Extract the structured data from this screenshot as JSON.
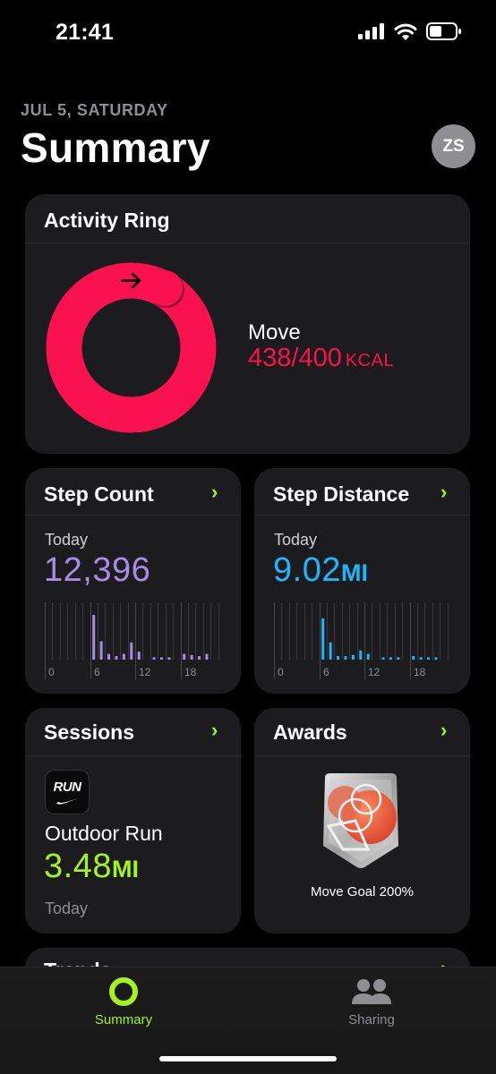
{
  "status_bar": {
    "time": "21:41"
  },
  "header": {
    "date": "JUL 5, SATURDAY",
    "title": "Summary",
    "avatar_initials": "ZS"
  },
  "activity_ring": {
    "title": "Activity Ring",
    "move_label": "Move",
    "move_value": "438/400",
    "move_unit": "KCAL",
    "progress_fraction": 1.095,
    "color": "#fa114f"
  },
  "step_count": {
    "title": "Step Count",
    "period": "Today",
    "value": "12,396",
    "color": "#a68ce8",
    "chart_ticks": [
      "0",
      "6",
      "12",
      "18"
    ]
  },
  "step_distance": {
    "title": "Step Distance",
    "period": "Today",
    "value": "9.02",
    "unit": "MI",
    "color": "#1fb6ff",
    "chart_ticks": [
      "0",
      "6",
      "12",
      "18"
    ]
  },
  "sessions": {
    "title": "Sessions",
    "badge_text": "RUN",
    "workout": "Outdoor Run",
    "value": "3.48",
    "unit": "MI",
    "date": "Today",
    "color": "#a5f21e"
  },
  "awards": {
    "title": "Awards",
    "award_name": "Move Goal 200%"
  },
  "next_card": {
    "title": "Trends"
  },
  "tabbar": {
    "summary_label": "Summary",
    "sharing_label": "Sharing",
    "active_color": "#a5f21e"
  }
}
